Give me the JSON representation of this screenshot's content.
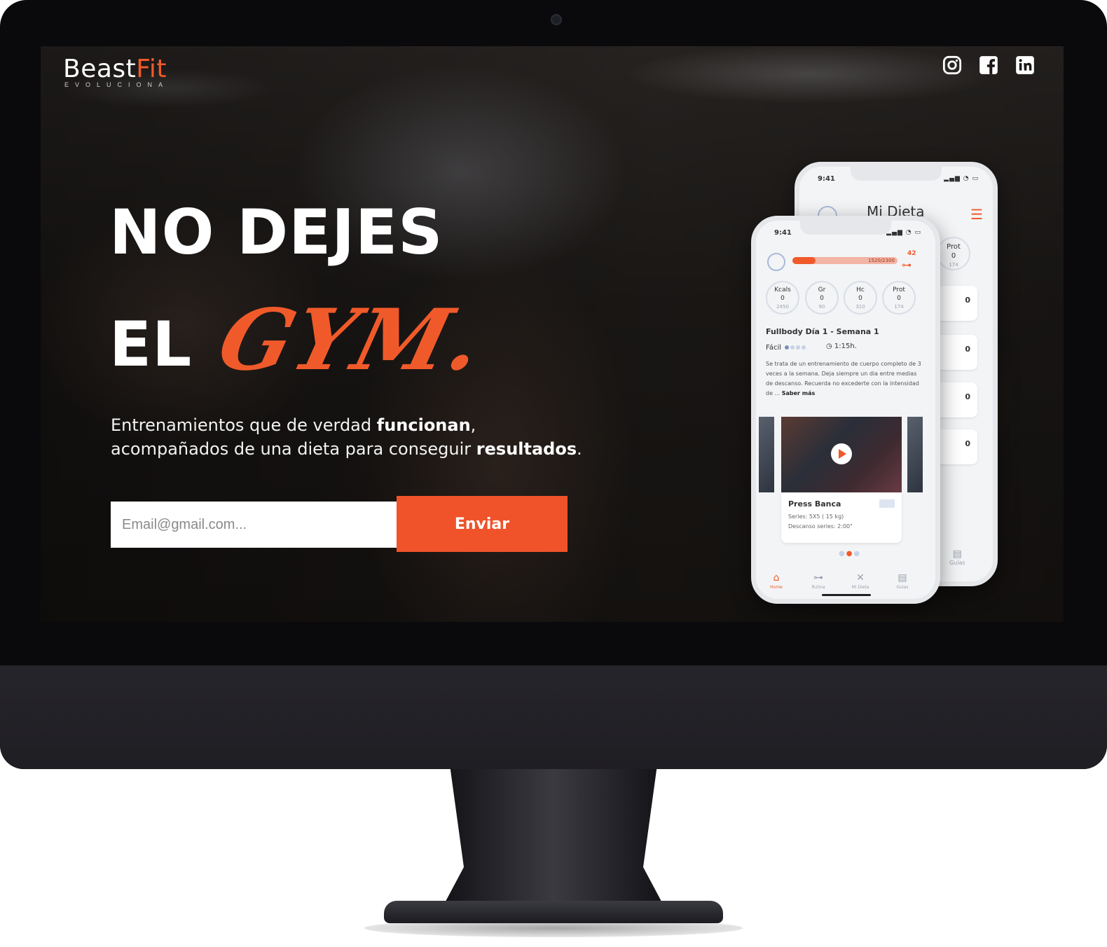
{
  "brand": {
    "name_part1": "Beast",
    "name_part2": "Fit",
    "tagline": "EVOLUCIONA",
    "accent_color": "#f05a2a"
  },
  "social": [
    {
      "icon": "instagram-icon"
    },
    {
      "icon": "facebook-icon"
    },
    {
      "icon": "linkedin-icon"
    }
  ],
  "hero": {
    "line1": "NO DEJES",
    "line2_prefix": "EL",
    "highlight": "GYM.",
    "subtitle_l1_a": "Entrenamientos que de verdad ",
    "subtitle_l1_b": "funcionan",
    "subtitle_l1_c": ",",
    "subtitle_l2_a": "acompañados de una dieta para conseguir ",
    "subtitle_l2_b": "resultados",
    "subtitle_l2_c": "."
  },
  "signup": {
    "email_placeholder": "Email@gmail.com...",
    "email_value": "",
    "send_label": "Enviar"
  },
  "phone_back": {
    "time": "9:41",
    "title": "Mi Dieta",
    "prot_label": "Prot",
    "prot_value": "0",
    "prot_goal": "174",
    "rows": [
      "0",
      "0",
      "0",
      "0"
    ],
    "guide_label": "Guías"
  },
  "phone_front": {
    "time": "9:41",
    "kcal_text": "1520/2300",
    "kcal_progress": 0.22,
    "streak": "42",
    "macros": [
      {
        "label": "Kcals",
        "value": "0",
        "goal": "2450"
      },
      {
        "label": "Gr",
        "value": "0",
        "goal": "90"
      },
      {
        "label": "Hc",
        "value": "0",
        "goal": "310"
      },
      {
        "label": "Prot",
        "value": "0",
        "goal": "174"
      }
    ],
    "workout_title": "Fullbody Día 1 - Semana 1",
    "level": "Fácil",
    "duration": "1:15h.",
    "description": "Se trata de un entrenamiento de cuerpo completo de 3 veces a la semana. Deja siempre un dia entre medias de descanso. Recuerda no excederte con la intensidad de ...",
    "read_more": "Saber más",
    "exercise": {
      "name": "Press Banca",
      "series": "Series: 5X5 ( 15 kg)",
      "rest": "Descanso series: 2:00\""
    },
    "tabs": [
      {
        "label": "Home",
        "icon": "home-icon"
      },
      {
        "label": "Rutina",
        "icon": "dumbbell-icon"
      },
      {
        "label": "Mi Dieta",
        "icon": "cutlery-icon"
      },
      {
        "label": "Guías",
        "icon": "book-icon"
      }
    ]
  }
}
